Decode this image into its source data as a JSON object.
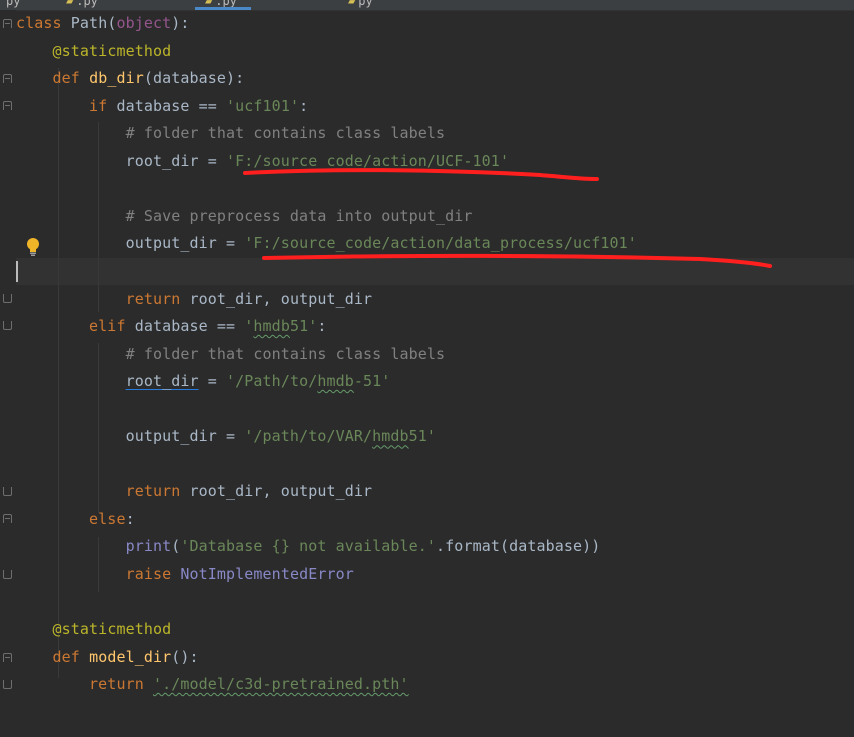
{
  "tabs": [
    {
      "label": "py",
      "icon": "",
      "active": false
    },
    {
      "label": ".py",
      "icon": "python-file-icon",
      "active": false
    },
    {
      "label": ".py",
      "icon": "python-file-icon",
      "active": true
    },
    {
      "label": "py",
      "icon": "python-file-icon",
      "active": false
    }
  ],
  "colors": {
    "background": "#2b2b2b",
    "keyword": "#cc7832",
    "function": "#ffc66d",
    "string": "#6a8759",
    "comment": "#808080",
    "decorator": "#bbb529",
    "annotation": "#ff1f1f"
  },
  "lines": [
    {
      "tokens": [
        [
          "kw",
          "class "
        ],
        [
          "plain",
          "Path("
        ],
        [
          "self",
          "object"
        ],
        [
          "plain",
          "):"
        ]
      ]
    },
    {
      "tokens": [
        [
          "plain",
          "    "
        ],
        [
          "deco",
          "@staticmethod"
        ]
      ]
    },
    {
      "tokens": [
        [
          "plain",
          "    "
        ],
        [
          "kw",
          "def "
        ],
        [
          "fn",
          "db_dir"
        ],
        [
          "plain",
          "(database):"
        ]
      ]
    },
    {
      "tokens": [
        [
          "plain",
          "        "
        ],
        [
          "kw",
          "if "
        ],
        [
          "plain",
          "database == "
        ],
        [
          "str",
          "'ucf101'"
        ],
        [
          "plain",
          ":"
        ]
      ]
    },
    {
      "tokens": [
        [
          "plain",
          "            "
        ],
        [
          "cmt",
          "# folder that contains class labels"
        ]
      ]
    },
    {
      "tokens": [
        [
          "plain",
          "            root_dir = "
        ],
        [
          "str",
          "'F:/source_code/action/UCF-101'"
        ]
      ]
    },
    {
      "tokens": []
    },
    {
      "tokens": [
        [
          "plain",
          "            "
        ],
        [
          "cmt",
          "# Save preprocess data into output_dir"
        ]
      ]
    },
    {
      "tokens": [
        [
          "plain",
          "            output_dir = "
        ],
        [
          "str",
          "'F:/source_code/action/data_process/ucf101'"
        ]
      ]
    },
    {
      "tokens": []
    },
    {
      "tokens": [
        [
          "plain",
          "            "
        ],
        [
          "kw",
          "return "
        ],
        [
          "plain",
          "root_dir, output_dir"
        ]
      ]
    },
    {
      "tokens": [
        [
          "plain",
          "        "
        ],
        [
          "kw",
          "elif "
        ],
        [
          "plain",
          "database == "
        ],
        [
          "str",
          "'"
        ],
        [
          "str typo",
          "hmdb"
        ],
        [
          "str",
          "51'"
        ],
        [
          "plain",
          ":"
        ]
      ]
    },
    {
      "tokens": [
        [
          "plain",
          "            "
        ],
        [
          "cmt",
          "# folder that contains class labels"
        ]
      ]
    },
    {
      "tokens": [
        [
          "plain",
          "            "
        ],
        [
          "plain shadow",
          "root_dir"
        ],
        [
          "plain",
          " = "
        ],
        [
          "str",
          "'/Path/to/"
        ],
        [
          "str typo",
          "hmdb"
        ],
        [
          "str",
          "-51'"
        ]
      ]
    },
    {
      "tokens": []
    },
    {
      "tokens": [
        [
          "plain",
          "            output_dir = "
        ],
        [
          "str",
          "'/path/to/VAR/"
        ],
        [
          "str typo",
          "hmdb"
        ],
        [
          "str",
          "51'"
        ]
      ]
    },
    {
      "tokens": []
    },
    {
      "tokens": [
        [
          "plain",
          "            "
        ],
        [
          "kw",
          "return "
        ],
        [
          "plain",
          "root_dir, output_dir"
        ]
      ]
    },
    {
      "tokens": [
        [
          "plain",
          "        "
        ],
        [
          "kw",
          "else"
        ],
        [
          "plain",
          ":"
        ]
      ]
    },
    {
      "tokens": [
        [
          "plain",
          "            "
        ],
        [
          "builtin",
          "print"
        ],
        [
          "plain",
          "("
        ],
        [
          "str",
          "'Database {} not available.'"
        ],
        [
          "plain",
          ".format(database))"
        ]
      ]
    },
    {
      "tokens": [
        [
          "plain",
          "            "
        ],
        [
          "kw",
          "raise "
        ],
        [
          "builtin",
          "NotImplementedError"
        ]
      ]
    },
    {
      "tokens": []
    },
    {
      "tokens": [
        [
          "plain",
          "    "
        ],
        [
          "deco",
          "@staticmethod"
        ]
      ]
    },
    {
      "tokens": [
        [
          "plain",
          "    "
        ],
        [
          "kw",
          "def "
        ],
        [
          "fn",
          "model_dir"
        ],
        [
          "plain",
          "():"
        ]
      ]
    },
    {
      "tokens": [
        [
          "plain",
          "        "
        ],
        [
          "kw",
          "return "
        ],
        [
          "str typo",
          "'./model/c3d-pretrained.pth'"
        ]
      ]
    }
  ]
}
